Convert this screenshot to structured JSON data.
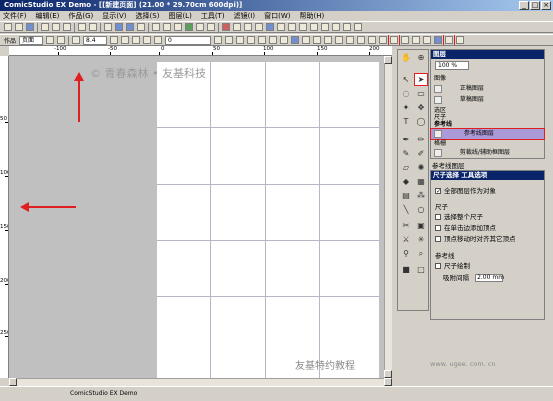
{
  "window": {
    "title": "ComicStudio EX Demo - [[新建页面] (21.00 * 29.70cm 600dpi)]",
    "min_glyph": "_",
    "max_glyph": "□",
    "close_glyph": "×"
  },
  "menu": {
    "items": [
      "文件(F)",
      "编辑(E)",
      "作品(G)",
      "显示(V)",
      "选择(S)",
      "图层(L)",
      "工具(T)",
      "滤镜(I)",
      "窗口(W)",
      "帮助(H)"
    ]
  },
  "toolbar2": {
    "label": "作品",
    "page_combo": "页面",
    "size_value": "8.4",
    "opacity_value": "0"
  },
  "rulers": {
    "horizontal_labels": [
      "-100",
      "-50",
      "0",
      "50",
      "100",
      "150",
      "200",
      "250",
      "300"
    ],
    "vertical_labels": [
      "50",
      "100",
      "150",
      "200",
      "250"
    ]
  },
  "watermarks": {
    "top": "© 青春森林 • 友基科技",
    "bottom": "友基特约教程",
    "url": "www. ugee. com. cn"
  },
  "status": {
    "text": "ComicStudio EX Demo"
  },
  "layer_panel": {
    "title": "图层",
    "zoom": "100 %",
    "groups": [
      {
        "label": "图像"
      },
      {
        "label": "正稿图层"
      },
      {
        "label": "草稿图层"
      },
      {
        "label": "选区"
      },
      {
        "label": "尺子"
      },
      {
        "label": "参考线"
      },
      {
        "label": "参考线图层"
      },
      {
        "label": "格栅"
      },
      {
        "label": "剪裁线/辅助框图层"
      }
    ],
    "footer": "参考线图层"
  },
  "props_panel": {
    "title": "尺子选择  工具选项",
    "all_layers_target": "全部图层作为对象",
    "section_ruler": "尺子",
    "select_all_ruler": "选择整个尺子",
    "add_control_point": "在单击边添加顶点",
    "align_other_points": "顶点移动时对齐其它顶点",
    "section_guide": "参考线",
    "guide_ruler": "尺子绘制",
    "snap_distance_label": "吸附间隔",
    "snap_distance_value": "2.00 mm"
  },
  "colors": {
    "title_bar_start": "#0a246a",
    "title_bar_end": "#a6caf0",
    "highlight_red": "#e02020",
    "selected_layer": "#ab9ad8",
    "canvas_bg": "#c0c0c0"
  }
}
